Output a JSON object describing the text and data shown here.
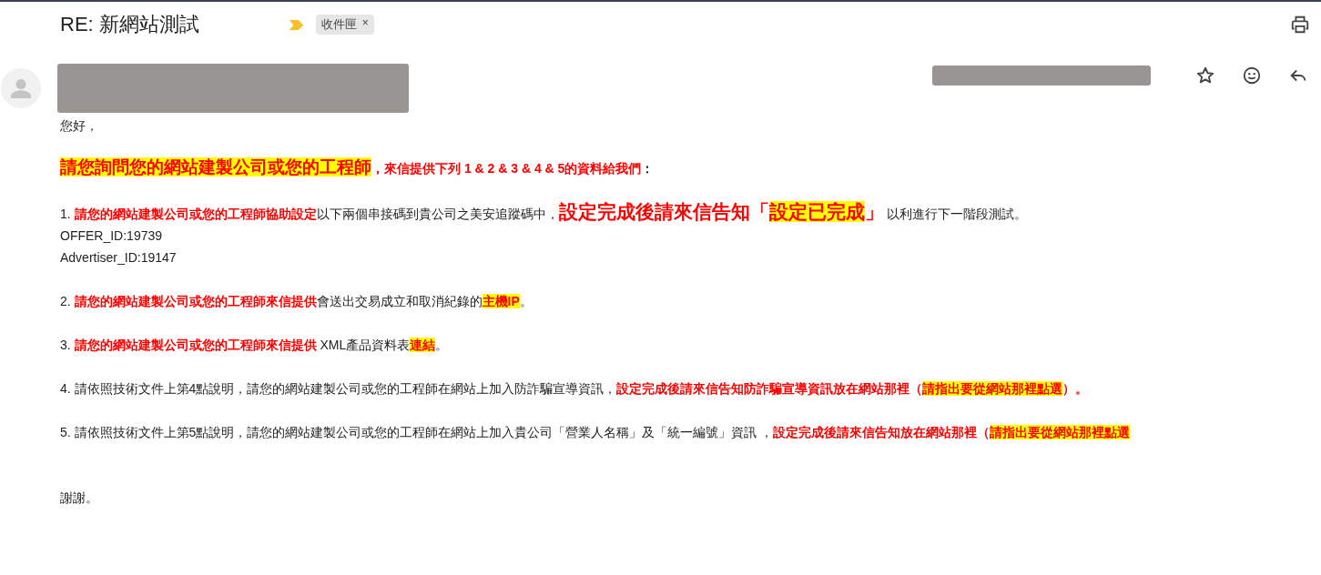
{
  "subject": "RE: 新網站測試",
  "labels": [
    {
      "text": "收件匣",
      "remove": "×"
    }
  ],
  "body": [
    {
      "kind": "plain",
      "segments": [
        {
          "kind": "plain",
          "text": "您好，"
        }
      ]
    },
    {
      "kind": "gap-lead",
      "segments": [
        {
          "kind": "big-red-marked",
          "text": "請您詢問您的網站建製公司或您的工程師"
        },
        {
          "kind": "red",
          "text": "，來信提供下列 1 & 2 & 3 & 4 & 5的資料給我們"
        },
        {
          "kind": "plain-bold",
          "text": "："
        }
      ]
    },
    {
      "kind": "gap",
      "segments": [
        {
          "kind": "plain",
          "text": "1. "
        },
        {
          "kind": "red",
          "text": "請您的網站建製公司或您的工程師協助設定"
        },
        {
          "kind": "plain",
          "text": "以下兩個串接碼到貴公司之美安追蹤碼中，"
        },
        {
          "kind": "big-red",
          "text": "設定完成後請來信告知「"
        },
        {
          "kind": "big-red-marked",
          "text": "設定已完成"
        },
        {
          "kind": "big-red",
          "text": "」"
        },
        {
          "kind": "plain",
          "text": " 以利進行下一階段測試。"
        }
      ]
    },
    {
      "kind": "plain",
      "segments": [
        {
          "kind": "plain",
          "text": "OFFER_ID:19739"
        }
      ]
    },
    {
      "kind": "plain",
      "segments": [
        {
          "kind": "plain",
          "text": "Advertiser_ID:19147"
        }
      ]
    },
    {
      "kind": "gap",
      "segments": [
        {
          "kind": "plain",
          "text": "2. "
        },
        {
          "kind": "red",
          "text": "請您的網站建製公司或您的工程師來信提供"
        },
        {
          "kind": "plain",
          "text": "會送出交易成立和取消紀錄的"
        },
        {
          "kind": "red-marked",
          "text": "主機IP"
        },
        {
          "kind": "plain",
          "text": "。"
        }
      ]
    },
    {
      "kind": "gap",
      "segments": [
        {
          "kind": "plain",
          "text": "3. "
        },
        {
          "kind": "red",
          "text": "請您的網站建製公司或您的工程師來信提供"
        },
        {
          "kind": "plain",
          "text": " XML產品資料表"
        },
        {
          "kind": "red-marked",
          "text": "連結"
        },
        {
          "kind": "plain",
          "text": "。"
        }
      ]
    },
    {
      "kind": "gap",
      "segments": [
        {
          "kind": "plain",
          "text": "4. 請依照技術文件上第4點說明，請您的網站建製公司或您的工程師在網站上加入防詐騙宣導資訊，"
        },
        {
          "kind": "red",
          "text": "設定完成後請來信告知防詐騙宣導資訊放在網站那裡（"
        },
        {
          "kind": "red-marked",
          "text": "請指出要從網站那裡點選"
        },
        {
          "kind": "red",
          "text": "）。"
        }
      ]
    },
    {
      "kind": "gap",
      "segments": [
        {
          "kind": "plain",
          "text": "5. 請依照技術文件上第5點說明，請您的網站建製公司或您的工程師在網站上加入貴公司「營業人名稱」及「統一編號」資訊 ，"
        },
        {
          "kind": "red",
          "text": "設定完成後請來信告知放在網站那裡（"
        },
        {
          "kind": "red-marked",
          "text": "請指出要從網站那裡點選"
        }
      ]
    },
    {
      "kind": "gap-end",
      "segments": [
        {
          "kind": "plain",
          "text": "謝謝。"
        }
      ]
    }
  ]
}
